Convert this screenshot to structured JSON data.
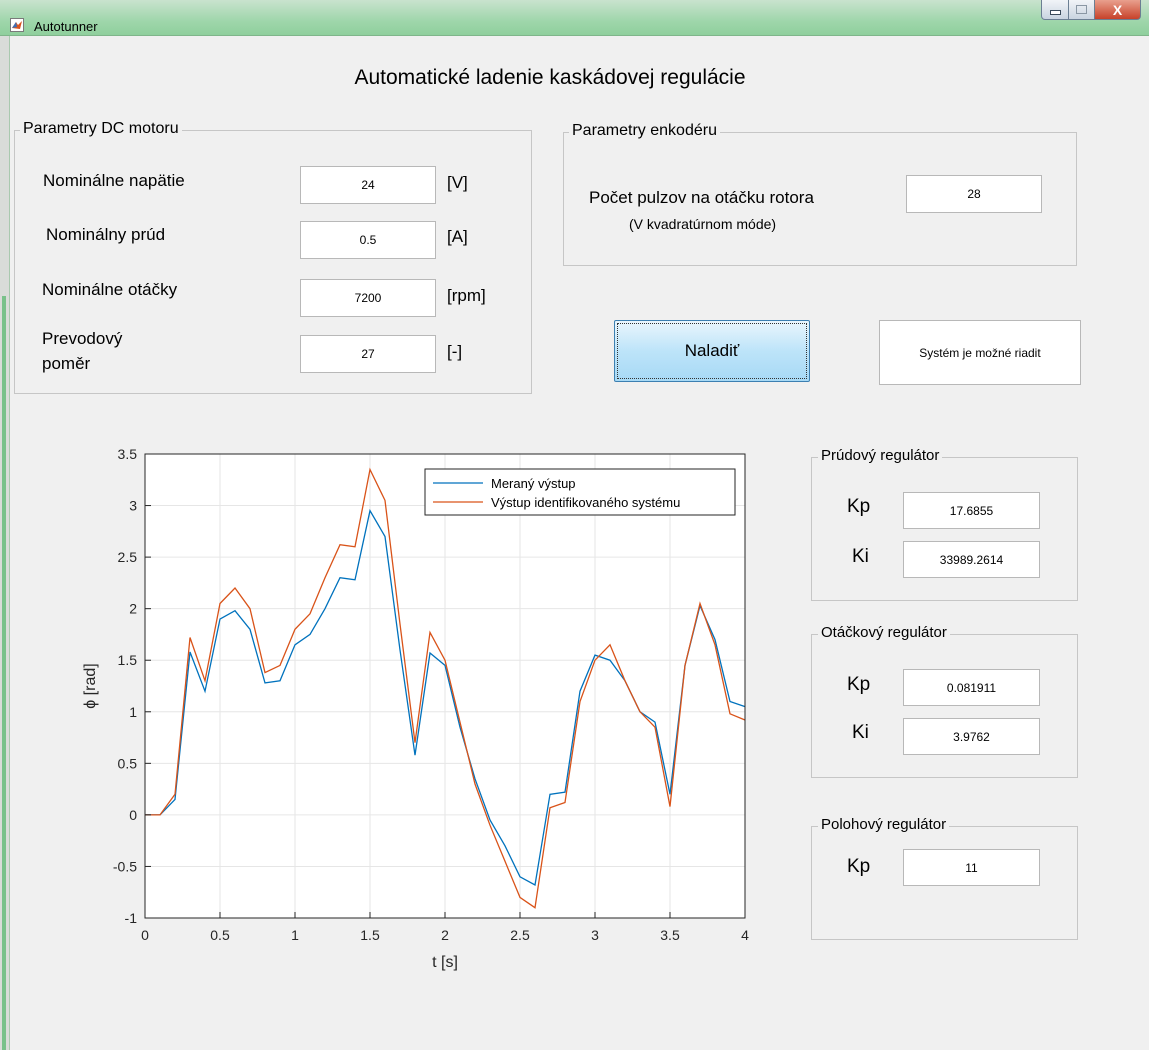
{
  "window": {
    "title": "Autotunner",
    "close_glyph": "X"
  },
  "main_title": "Automatické ladenie kaskádovej regulácie",
  "motor": {
    "title": "Parametry DC motoru",
    "rows": [
      {
        "label": "Nominálne napätie",
        "value": "24",
        "unit": "[V]"
      },
      {
        "label": "Nominálny prúd",
        "value": "0.5",
        "unit": "[A]"
      },
      {
        "label": "Nominálne otáčky",
        "value": "7200",
        "unit": "[rpm]"
      },
      {
        "label_line1": "Prevodový",
        "label_line2": "poměr",
        "value": "27",
        "unit": "[-]"
      }
    ]
  },
  "encoder": {
    "title": "Parametry enkodéru",
    "label": "Počet pulzov na otáčku rotora",
    "sublabel": "(V kvadratúrnom móde)",
    "value": "28"
  },
  "tune_button": "Naladiť",
  "status_text": "Systém je možné riadit",
  "current_reg": {
    "title": "Prúdový regulátor",
    "kp_label": "Kp",
    "kp": "17.6855",
    "ki_label": "Ki",
    "ki": "33989.2614"
  },
  "speed_reg": {
    "title": "Otáčkový regulátor",
    "kp_label": "Kp",
    "kp": "0.081911",
    "ki_label": "Ki",
    "ki": "3.9762"
  },
  "position_reg": {
    "title": "Polohový regulátor",
    "kp_label": "Kp",
    "kp": "11"
  },
  "colors": {
    "series_measured": "#0072bd",
    "series_model": "#d95319",
    "titlebar": "#9fd6ab"
  },
  "chart_data": {
    "type": "line",
    "xlabel": "t [s]",
    "ylabel": "ϕ [rad]",
    "xlim": [
      0,
      4
    ],
    "ylim": [
      -1,
      3.5
    ],
    "xticks": [
      0,
      0.5,
      1,
      1.5,
      2,
      2.5,
      3,
      3.5,
      4
    ],
    "xtick_labels": [
      "0",
      "0.5",
      "1",
      "1.5",
      "2",
      "2.5",
      "3",
      "3.5",
      "4"
    ],
    "yticks": [
      -1,
      -0.5,
      0,
      0.5,
      1,
      1.5,
      2,
      2.5,
      3,
      3.5
    ],
    "ytick_labels": [
      "-1",
      "-0.5",
      "0",
      "0.5",
      "1",
      "1.5",
      "2",
      "2.5",
      "3",
      "3.5"
    ],
    "grid": true,
    "legend_position": "top-right",
    "series": [
      {
        "name": "Meraný výstup",
        "x": [
          0,
          0.1,
          0.2,
          0.3,
          0.4,
          0.5,
          0.6,
          0.7,
          0.8,
          0.9,
          1.0,
          1.1,
          1.2,
          1.3,
          1.4,
          1.5,
          1.6,
          1.7,
          1.8,
          1.9,
          2.0,
          2.1,
          2.2,
          2.3,
          2.4,
          2.5,
          2.6,
          2.7,
          2.8,
          2.9,
          3.0,
          3.1,
          3.2,
          3.3,
          3.4,
          3.5,
          3.6,
          3.7,
          3.8,
          3.9,
          4.0
        ],
        "y": [
          0,
          0,
          0.15,
          1.58,
          1.2,
          1.9,
          1.98,
          1.8,
          1.28,
          1.3,
          1.65,
          1.75,
          2.0,
          2.3,
          2.28,
          2.95,
          2.7,
          1.6,
          0.58,
          1.57,
          1.45,
          0.85,
          0.35,
          -0.05,
          -0.3,
          -0.6,
          -0.68,
          0.2,
          0.22,
          1.2,
          1.55,
          1.5,
          1.3,
          1.0,
          0.9,
          0.2,
          1.45,
          2.03,
          1.7,
          1.1,
          1.05
        ]
      },
      {
        "name": "Výstup identifikovaného systému",
        "x": [
          0,
          0.1,
          0.2,
          0.3,
          0.4,
          0.5,
          0.6,
          0.7,
          0.8,
          0.9,
          1.0,
          1.1,
          1.2,
          1.3,
          1.4,
          1.5,
          1.6,
          1.7,
          1.8,
          1.9,
          2.0,
          2.1,
          2.2,
          2.3,
          2.4,
          2.5,
          2.6,
          2.7,
          2.8,
          2.9,
          3.0,
          3.1,
          3.2,
          3.3,
          3.4,
          3.5,
          3.6,
          3.7,
          3.8,
          3.9,
          4.0
        ],
        "y": [
          0,
          0,
          0.2,
          1.72,
          1.3,
          2.05,
          2.2,
          2.0,
          1.38,
          1.45,
          1.8,
          1.95,
          2.3,
          2.62,
          2.6,
          3.35,
          3.05,
          1.85,
          0.7,
          1.77,
          1.5,
          0.9,
          0.3,
          -0.1,
          -0.45,
          -0.8,
          -0.9,
          0.07,
          0.12,
          1.1,
          1.5,
          1.65,
          1.3,
          1.0,
          0.85,
          0.08,
          1.45,
          2.05,
          1.65,
          0.98,
          0.92
        ]
      }
    ]
  }
}
